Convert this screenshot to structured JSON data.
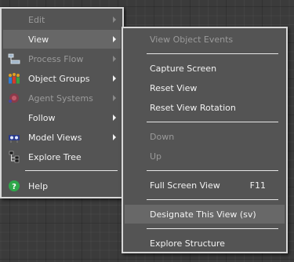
{
  "main_menu": {
    "items": [
      {
        "label": "Edit",
        "state": "disabled",
        "submenu": true
      },
      {
        "label": "View",
        "state": "active",
        "submenu": true
      },
      {
        "label": "Process Flow",
        "state": "disabled",
        "submenu": true,
        "icon": "process-flow-icon"
      },
      {
        "label": "Object Groups",
        "state": "enabled",
        "submenu": true,
        "icon": "object-groups-icon"
      },
      {
        "label": "Agent Systems",
        "state": "disabled",
        "submenu": true,
        "icon": "agent-systems-icon"
      },
      {
        "label": "Follow",
        "state": "enabled",
        "submenu": true
      },
      {
        "label": "Model Views",
        "state": "enabled",
        "submenu": true,
        "icon": "model-views-icon"
      },
      {
        "label": "Explore Tree",
        "state": "enabled",
        "submenu": false,
        "icon": "explore-tree-icon"
      },
      {
        "label": "Help",
        "state": "enabled",
        "submenu": false,
        "icon": "help-icon"
      }
    ]
  },
  "view_submenu": {
    "items": [
      {
        "label": "View Object Events",
        "state": "disabled"
      },
      {
        "label": "Capture Screen",
        "state": "enabled"
      },
      {
        "label": "Reset View",
        "state": "enabled"
      },
      {
        "label": "Reset View Rotation",
        "state": "enabled"
      },
      {
        "label": "Down",
        "state": "disabled"
      },
      {
        "label": "Up",
        "state": "disabled"
      },
      {
        "label": "Full Screen View",
        "state": "enabled",
        "shortcut": "F11"
      },
      {
        "label": "Designate This View (sv)",
        "state": "highlighted"
      },
      {
        "label": "Explore Structure",
        "state": "enabled"
      }
    ]
  },
  "colors": {
    "menu_bg": "#545454",
    "menu_border": "#d8d8d8",
    "text": "#f2f2f2",
    "disabled_text": "#9a9a9a",
    "highlight": "#686868"
  }
}
